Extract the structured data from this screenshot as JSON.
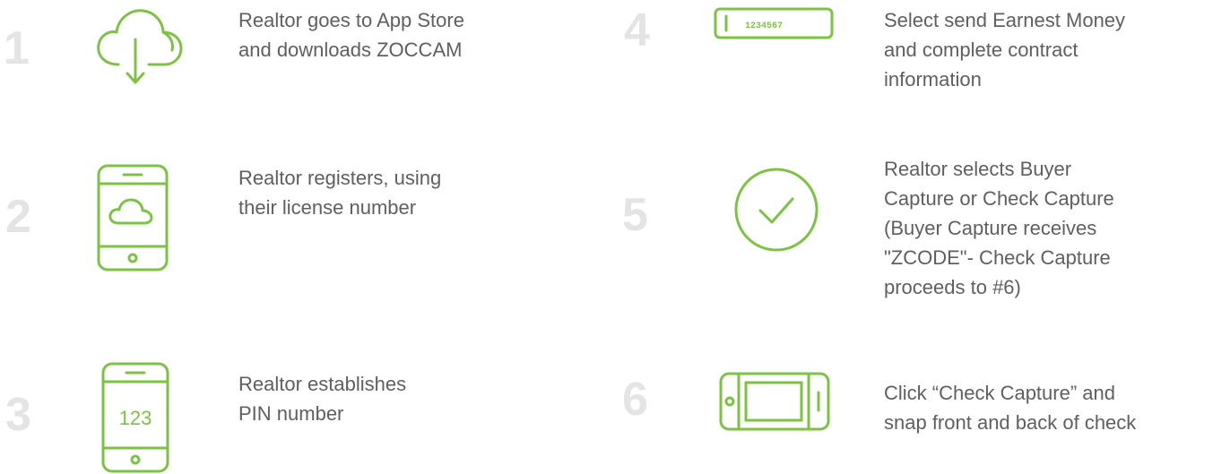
{
  "accent": "#7dc243",
  "number_color": "#e4e4e4",
  "text_color": "#5f5f5f",
  "steps": [
    {
      "number": "1",
      "icon": "cloud-download-icon",
      "text": "Realtor goes to App Store\nand downloads ZOCCAM"
    },
    {
      "number": "2",
      "icon": "phone-cloud-icon",
      "text": "Realtor registers, using\ntheir license number"
    },
    {
      "number": "3",
      "icon": "phone-pin-icon",
      "icon_text": "123",
      "text": "Realtor establishes\nPIN number"
    },
    {
      "number": "4",
      "icon": "check-number-icon",
      "icon_text": "1234567",
      "text": "Select send Earnest Money\nand complete contract\ninformation"
    },
    {
      "number": "5",
      "icon": "checkmark-circle-icon",
      "text": "Realtor selects Buyer\nCapture or Check Capture\n(Buyer Capture receives\n\"ZCODE\"- Check Capture\nproceeds to #6)"
    },
    {
      "number": "6",
      "icon": "phone-landscape-icon",
      "text": "Click “Check Capture” and\nsnap front and back of check"
    }
  ]
}
